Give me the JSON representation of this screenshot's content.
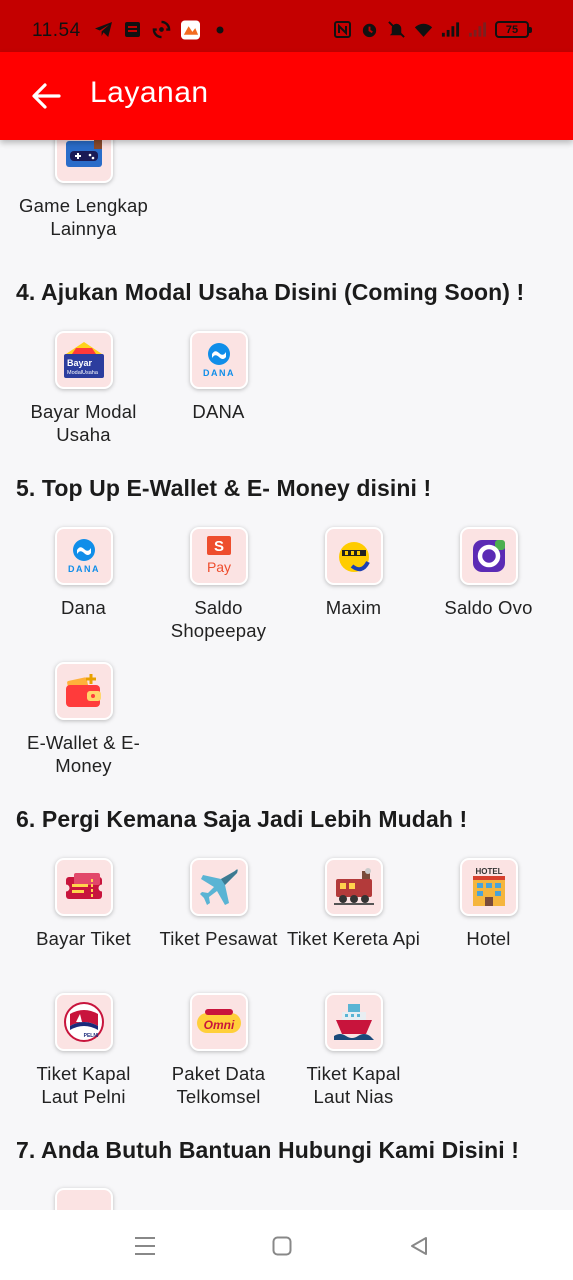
{
  "status_bar": {
    "time": "11.54",
    "battery": "75",
    "left_icons": [
      "telegram-icon",
      "wifi-tag-icon",
      "sync-icon",
      "app-icon",
      "dot-icon"
    ],
    "right_icons": [
      "nfc-icon",
      "alarm-icon",
      "mute-icon",
      "wifi-icon",
      "signal-icon",
      "signal-icon-2"
    ]
  },
  "app_bar": {
    "title": "Layanan",
    "background": "#ff0000"
  },
  "sections": {
    "s3": {
      "items": [
        {
          "label": "Game Lengkap Lainnya",
          "icon": "gamepad-icon"
        }
      ]
    },
    "s4": {
      "title": "4. Ajukan Modal Usaha Disini (Coming Soon) !",
      "items": [
        {
          "label": "Bayar Modal Usaha",
          "icon": "bayar-modal-usaha-logo",
          "logo_text": "Bayar",
          "logo_subtext": "ModalUsaha"
        },
        {
          "label": "DANA",
          "icon": "dana-logo",
          "logo_text": "DANA"
        }
      ]
    },
    "s5": {
      "title": "5. Top Up E-Wallet & E- Money disini !",
      "items": [
        {
          "label": "Dana",
          "icon": "dana-logo",
          "logo_text": "DANA"
        },
        {
          "label": "Saldo Shopeepay",
          "icon": "shopeepay-logo",
          "logo_text": "Pay"
        },
        {
          "label": "Maxim",
          "icon": "maxim-taxi-icon"
        },
        {
          "label": "Saldo Ovo",
          "icon": "ovo-icon"
        },
        {
          "label": "E-Wallet & E-Money",
          "icon": "wallet-icon"
        }
      ]
    },
    "s6": {
      "title": "6. Pergi Kemana Saja Jadi Lebih Mudah !",
      "items": [
        {
          "label": "Bayar Tiket",
          "icon": "ticket-icon"
        },
        {
          "label": "Tiket Pesawat",
          "icon": "airplane-icon"
        },
        {
          "label": "Tiket Kereta Api",
          "icon": "train-icon"
        },
        {
          "label": "Hotel",
          "icon": "hotel-icon",
          "logo_text": "HOTEL"
        },
        {
          "label": "Tiket Kapal Laut Pelni",
          "icon": "pelni-icon",
          "logo_text": "PELNI"
        },
        {
          "label": "Paket Data Telkomsel",
          "icon": "telkomsel-omni-logo",
          "logo_text": "Omni"
        },
        {
          "label": "Tiket Kapal Laut Nias",
          "icon": "ship-icon"
        }
      ]
    },
    "s7": {
      "title": "7. Anda Butuh Bantuan Hubungi Kami Disini !"
    }
  },
  "nav_bar": {
    "buttons": [
      "menu-icon",
      "home-square-icon",
      "back-triangle-icon"
    ]
  }
}
